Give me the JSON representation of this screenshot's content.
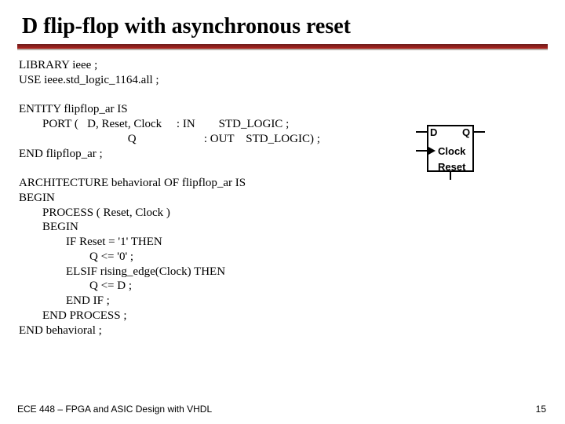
{
  "title": "D flip-flop with asynchronous reset",
  "code": "LIBRARY ieee ;\nUSE ieee.std_logic_1164.all ;\n\nENTITY flipflop_ar IS\n        PORT (   D, Reset, Clock     : IN        STD_LOGIC ;\n                                     Q                       : OUT    STD_LOGIC) ;\nEND flipflop_ar ;\n\nARCHITECTURE behavioral OF flipflop_ar IS\nBEGIN\n        PROCESS ( Reset, Clock )\n        BEGIN\n                IF Reset = '1' THEN\n                        Q <= '0' ;\n                ELSIF rising_edge(Clock) THEN\n                        Q <= D ;\n                END IF ;\n        END PROCESS ;\nEND behavioral ;",
  "diagram": {
    "d": "D",
    "q": "Q",
    "clock": "Clock",
    "reset": "Reset"
  },
  "footer": "ECE 448 – FPGA and ASIC Design with VHDL",
  "page": "15"
}
